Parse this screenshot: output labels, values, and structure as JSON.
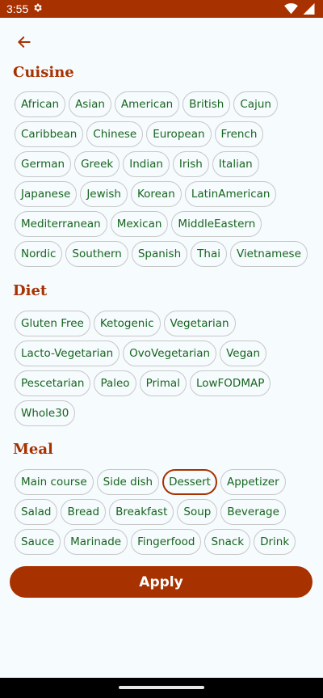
{
  "status_bar": {
    "time": "3:55",
    "colors": {
      "background": "#a83100",
      "icons": "#ffffff"
    },
    "icons": [
      "gear-icon",
      "wifi-icon",
      "signal-icon"
    ]
  },
  "header": {
    "back_icon": "arrow-left-icon"
  },
  "sections": {
    "cuisine": {
      "title": "Cuisine",
      "chips": [
        "African",
        "Asian",
        "American",
        "British",
        "Cajun",
        "Caribbean",
        "Chinese",
        "European",
        "French",
        "German",
        "Greek",
        "Indian",
        "Irish",
        "Italian",
        "Japanese",
        "Jewish",
        "Korean",
        "LatinAmerican",
        "Mediterranean",
        "Mexican",
        "MiddleEastern",
        "Nordic",
        "Southern",
        "Spanish",
        "Thai",
        "Vietnamese"
      ]
    },
    "diet": {
      "title": "Diet",
      "chips": [
        "Gluten Free",
        "Ketogenic",
        "Vegetarian",
        "Lacto-Vegetarian",
        "OvoVegetarian",
        "Vegan",
        "Pescetarian",
        "Paleo",
        "Primal",
        "LowFODMAP",
        "Whole30"
      ]
    },
    "meal": {
      "title": "Meal",
      "chips": [
        "Main course",
        "Side dish",
        "Dessert",
        "Appetizer",
        "Salad",
        "Bread",
        "Breakfast",
        "Soup",
        "Beverage",
        "Sauce",
        "Marinade",
        "Fingerfood",
        "Snack",
        "Drink"
      ],
      "selected": "Dessert"
    }
  },
  "apply_label": "Apply",
  "colors": {
    "accent": "#a83100",
    "chip_text": "#17651e",
    "chip_border": "#c7c7c7",
    "background": "#f6fbfe"
  }
}
